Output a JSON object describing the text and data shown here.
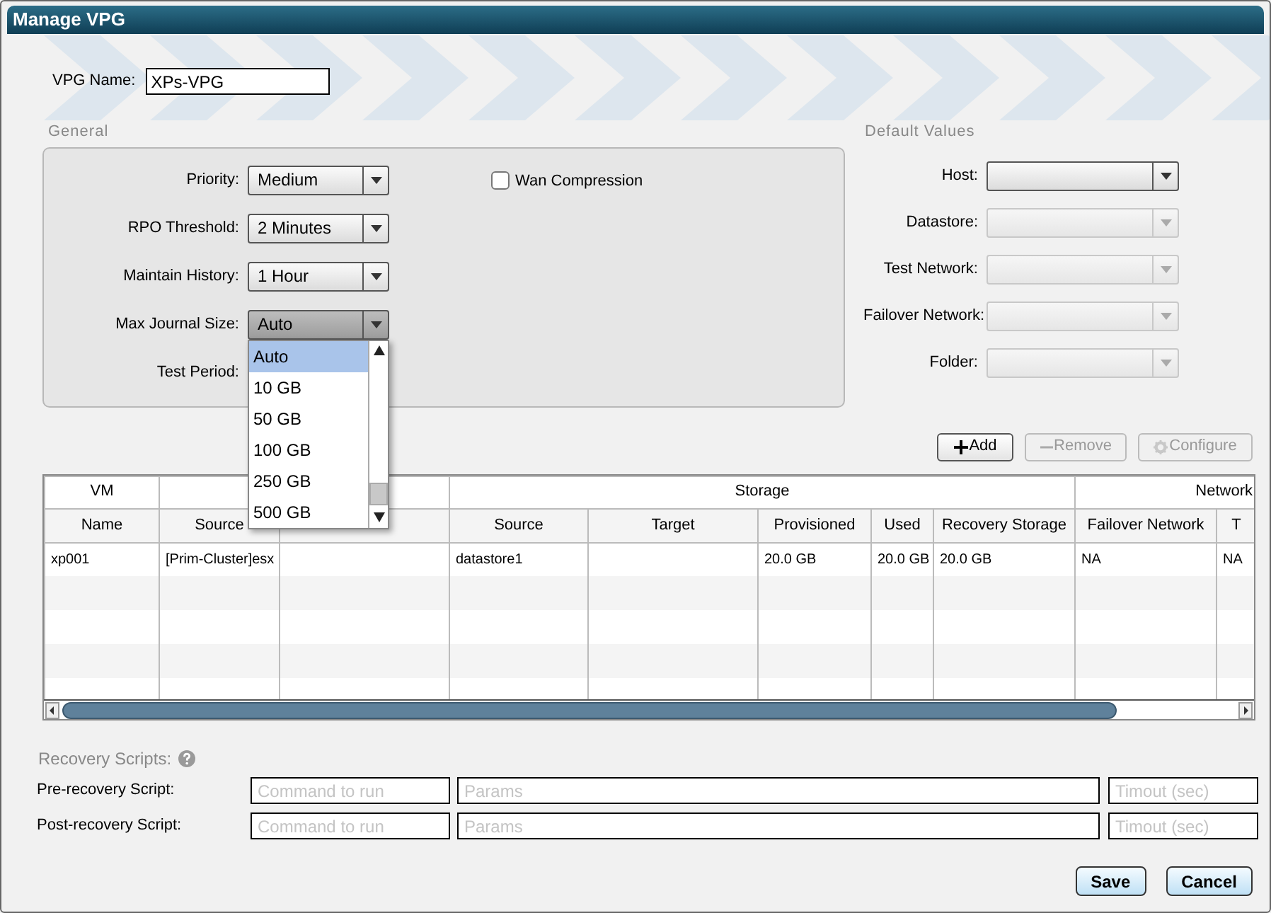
{
  "window": {
    "title": "Manage VPG"
  },
  "vpg_name": {
    "label": "VPG Name:",
    "value": "XPs-VPG"
  },
  "general": {
    "title": "General",
    "fields": [
      {
        "label": "Priority:",
        "kind": "select",
        "value": "Medium",
        "open": false
      },
      {
        "label": "RPO Threshold:",
        "kind": "select",
        "value": "2 Minutes",
        "open": false
      },
      {
        "label": "Maintain History:",
        "kind": "select",
        "value": "1 Hour",
        "open": false
      },
      {
        "label": "Max Journal Size:",
        "kind": "select",
        "value": "Auto",
        "open": true,
        "options": [
          {
            "label": "Auto",
            "selected": true
          },
          {
            "label": "10 GB",
            "selected": false
          },
          {
            "label": "50 GB",
            "selected": false
          },
          {
            "label": "100 GB",
            "selected": false
          },
          {
            "label": "250 GB",
            "selected": false
          },
          {
            "label": "500 GB",
            "selected": false
          }
        ]
      },
      {
        "label": "Test Period:",
        "kind": "covered"
      }
    ],
    "wan_compression": {
      "label": "Wan Compression",
      "checked": false
    }
  },
  "default_values": {
    "title": "Default Values",
    "fields": [
      {
        "label": "Host:",
        "disabled": false
      },
      {
        "label": "Datastore:",
        "disabled": true
      },
      {
        "label": "Test Network:",
        "disabled": true
      },
      {
        "label": "Failover Network:",
        "disabled": true
      },
      {
        "label": "Folder:",
        "disabled": true
      }
    ]
  },
  "table_buttons": [
    {
      "label": "Add",
      "kind": "add",
      "disabled": false
    },
    {
      "label": "Remove",
      "kind": "remove",
      "disabled": true
    },
    {
      "label": "Configure",
      "kind": "configure",
      "disabled": true
    }
  ],
  "table": {
    "groups": [
      {
        "label": "VM",
        "columns": [
          "Name"
        ]
      },
      {
        "columns": [
          "Source",
          null
        ]
      },
      {
        "label": "Storage",
        "columns": [
          "Source",
          "Target",
          "Provisioned",
          "Used",
          "Recovery Storage"
        ]
      },
      {
        "label": "Network",
        "columns": [
          "Failover Network",
          "T"
        ]
      }
    ],
    "rows": [
      [
        "xp001",
        "[Prim-Cluster]esx",
        null,
        "datastore1",
        null,
        "20.0 GB",
        "20.0 GB",
        "20.0 GB",
        "NA",
        "NA"
      ]
    ]
  },
  "recovery_scripts": {
    "title": "Recovery Scripts:",
    "rows": [
      {
        "label": "Pre-recovery Script:",
        "command_placeholder": "Command to run",
        "params_placeholder": "Params",
        "timeout_placeholder": "Timout (sec)"
      },
      {
        "label": "Post-recovery Script:",
        "command_placeholder": "Command to run",
        "params_placeholder": "Params",
        "timeout_placeholder": "Timout (sec)"
      }
    ]
  },
  "footer_buttons": [
    "Save",
    "Cancel"
  ]
}
